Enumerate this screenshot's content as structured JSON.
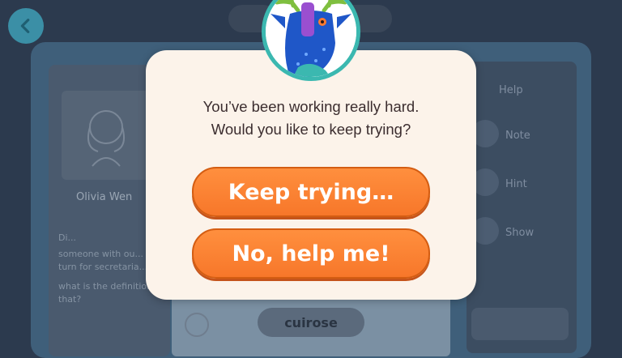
{
  "background": {
    "student_name": "Olivia Wen",
    "definition_label": "Di...",
    "definition_text": "someone with ou...\nturn for secretaria...",
    "question_text": "what is the definition\nthat?",
    "answer_word": "cuirose",
    "sidebar": {
      "title": "Help",
      "items": [
        {
          "label": "Note",
          "icon": "note-icon"
        },
        {
          "label": "Hint",
          "icon": "hint-icon"
        },
        {
          "label": "Show",
          "icon": "show-icon"
        }
      ]
    }
  },
  "modal": {
    "message_line1": "You’ve been working really hard.",
    "message_line2": "Would you like to keep trying?",
    "keep_trying_label": "Keep trying…",
    "help_label": "No, help me!",
    "avatar_icon": "deer-mascot-icon"
  },
  "colors": {
    "button": "#f7772a",
    "modal_bg": "#fcf3ea",
    "avatar_ring": "#3bb8b0",
    "overlay": "#2c3a4e"
  }
}
